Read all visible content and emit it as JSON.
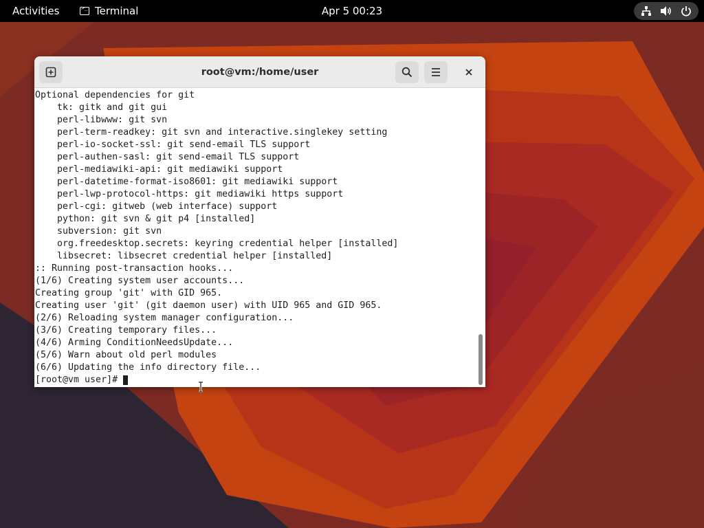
{
  "topbar": {
    "activities_label": "Activities",
    "app_name": "Terminal",
    "clock": "Apr 5  00:23",
    "status_icons": [
      "network-icon",
      "volume-icon",
      "power-icon"
    ]
  },
  "window": {
    "title": "root@vm:/home/user",
    "buttons": [
      "new-tab-icon",
      "search-icon",
      "menu-icon",
      "close-icon"
    ]
  },
  "terminal": {
    "lines": [
      "Optional dependencies for git",
      "    tk: gitk and git gui",
      "    perl-libwww: git svn",
      "    perl-term-readkey: git svn and interactive.singlekey setting",
      "    perl-io-socket-ssl: git send-email TLS support",
      "    perl-authen-sasl: git send-email TLS support",
      "    perl-mediawiki-api: git mediawiki support",
      "    perl-datetime-format-iso8601: git mediawiki support",
      "    perl-lwp-protocol-https: git mediawiki https support",
      "    perl-cgi: gitweb (web interface) support",
      "    python: git svn & git p4 [installed]",
      "    subversion: git svn",
      "    org.freedesktop.secrets: keyring credential helper [installed]",
      "    libsecret: libsecret credential helper [installed]",
      ":: Running post-transaction hooks...",
      "(1/6) Creating system user accounts...",
      "Creating group 'git' with GID 965.",
      "Creating user 'git' (git daemon user) with UID 965 and GID 965.",
      "(2/6) Reloading system manager configuration...",
      "(3/6) Creating temporary files...",
      "(4/6) Arming ConditionNeedsUpdate...",
      "(5/6) Warn about old perl modules",
      "(6/6) Updating the info directory file..."
    ],
    "prompt": "[root@vm user]# "
  },
  "colors": {
    "topbar_bg": "#000000",
    "wallpaper_dark": "#7a2a22",
    "wallpaper_orange": "#c44310",
    "terminal_bg": "#ffffff",
    "terminal_fg": "#1e1e1e",
    "headerbar_bg": "#ebebeb"
  }
}
